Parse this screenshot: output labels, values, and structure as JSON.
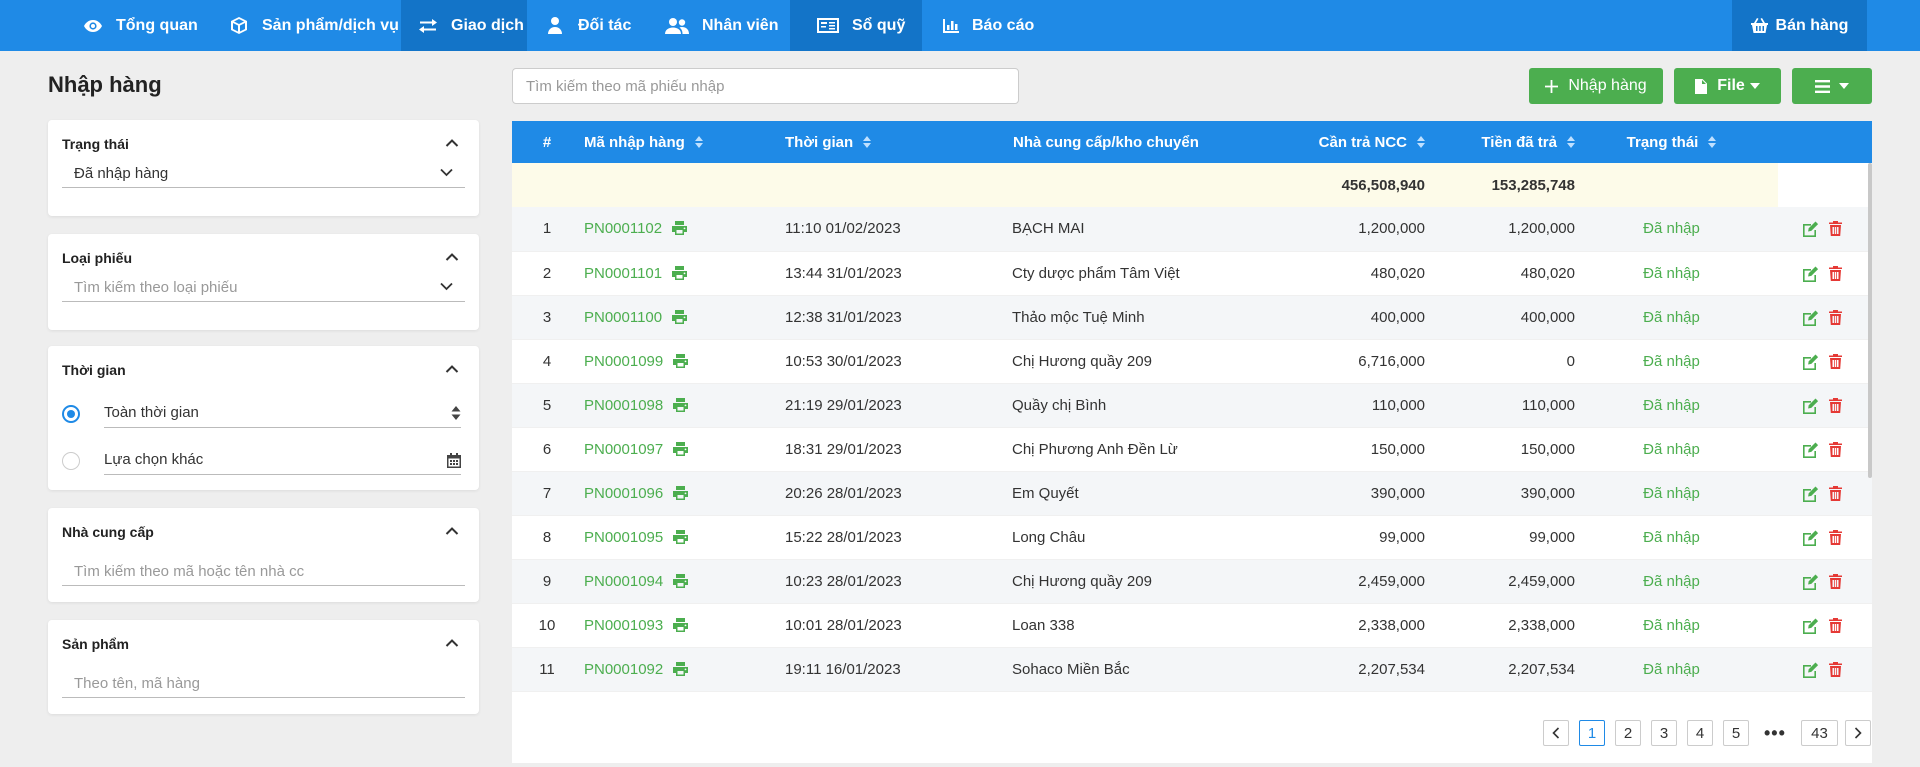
{
  "nav": {
    "items": [
      {
        "label": "Tổng quan"
      },
      {
        "label": "Sản phẩm/dịch vụ"
      },
      {
        "label": "Giao dịch"
      },
      {
        "label": "Đối tác"
      },
      {
        "label": "Nhân viên"
      },
      {
        "label": "Sổ quỹ"
      },
      {
        "label": "Báo cáo"
      }
    ],
    "sell_label": "Bán hàng"
  },
  "page": {
    "title": "Nhập hàng"
  },
  "filters": {
    "status": {
      "title": "Trạng thái",
      "value": "Đã nhập hàng"
    },
    "receipt_type": {
      "title": "Loại phiếu",
      "placeholder": "Tìm kiếm theo loại phiếu"
    },
    "time": {
      "title": "Thời gian",
      "option_all": "Toàn thời gian",
      "option_custom": "Lựa chọn khác"
    },
    "supplier": {
      "title": "Nhà cung cấp",
      "placeholder": "Tìm kiếm theo mã hoặc tên nhà cc"
    },
    "product": {
      "title": "Sản phẩm",
      "placeholder": "Theo tên, mã hàng"
    }
  },
  "toolbar": {
    "search_placeholder": "Tìm kiếm theo mã phiếu nhập",
    "import_label": "Nhập hàng",
    "file_label": "File"
  },
  "table": {
    "headers": {
      "num": "#",
      "code": "Mã nhập hàng",
      "time": "Thời gian",
      "supplier": "Nhà cung cấp/kho chuyển",
      "due": "Cần trả NCC",
      "paid": "Tiền đã trả",
      "status": "Trạng thái"
    },
    "totals": {
      "due": "456,508,940",
      "paid": "153,285,748"
    },
    "rows": [
      {
        "num": "1",
        "code": "PN0001102",
        "time": "11:10 01/02/2023",
        "supplier": "BẠCH MAI",
        "due": "1,200,000",
        "paid": "1,200,000",
        "status": "Đã nhập"
      },
      {
        "num": "2",
        "code": "PN0001101",
        "time": "13:44 31/01/2023",
        "supplier": "Cty dược phẩm Tâm Việt",
        "due": "480,020",
        "paid": "480,020",
        "status": "Đã nhập"
      },
      {
        "num": "3",
        "code": "PN0001100",
        "time": "12:38 31/01/2023",
        "supplier": "Thảo mộc Tuệ Minh",
        "due": "400,000",
        "paid": "400,000",
        "status": "Đã nhập"
      },
      {
        "num": "4",
        "code": "PN0001099",
        "time": "10:53 30/01/2023",
        "supplier": "Chị Hương quầy 209",
        "due": "6,716,000",
        "paid": "0",
        "status": "Đã nhập"
      },
      {
        "num": "5",
        "code": "PN0001098",
        "time": "21:19 29/01/2023",
        "supplier": "Quầy chị Bình",
        "due": "110,000",
        "paid": "110,000",
        "status": "Đã nhập"
      },
      {
        "num": "6",
        "code": "PN0001097",
        "time": "18:31 29/01/2023",
        "supplier": "Chị Phương Anh Đền Lừ",
        "due": "150,000",
        "paid": "150,000",
        "status": "Đã nhập"
      },
      {
        "num": "7",
        "code": "PN0001096",
        "time": "20:26 28/01/2023",
        "supplier": "Em Quyết",
        "due": "390,000",
        "paid": "390,000",
        "status": "Đã nhập"
      },
      {
        "num": "8",
        "code": "PN0001095",
        "time": "15:22 28/01/2023",
        "supplier": "Long Châu",
        "due": "99,000",
        "paid": "99,000",
        "status": "Đã nhập"
      },
      {
        "num": "9",
        "code": "PN0001094",
        "time": "10:23 28/01/2023",
        "supplier": "Chị Hương quầy 209",
        "due": "2,459,000",
        "paid": "2,459,000",
        "status": "Đã nhập"
      },
      {
        "num": "10",
        "code": "PN0001093",
        "time": "10:01 28/01/2023",
        "supplier": "Loan 338",
        "due": "2,338,000",
        "paid": "2,338,000",
        "status": "Đã nhập"
      },
      {
        "num": "11",
        "code": "PN0001092",
        "time": "19:11 16/01/2023",
        "supplier": "Sohaco Miền Bắc",
        "due": "2,207,534",
        "paid": "2,207,534",
        "status": "Đã nhập"
      }
    ]
  },
  "pagination": {
    "pages": [
      "1",
      "2",
      "3",
      "4",
      "5"
    ],
    "dots": "•••",
    "last": "43",
    "current": "1"
  },
  "colors": {
    "primary": "#1f8ae6",
    "primary_dark": "#1374c8",
    "success": "#4cae4f",
    "danger": "#e53935"
  }
}
